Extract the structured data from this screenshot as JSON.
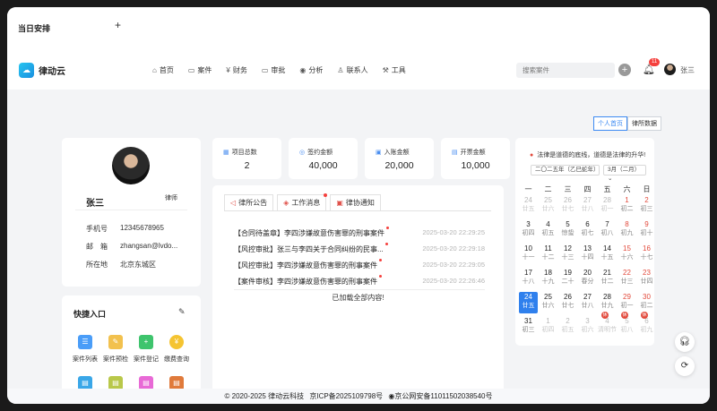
{
  "brand": {
    "name": "律动云",
    "logo_icon": "cloud-icon"
  },
  "nav": [
    {
      "label": "首页",
      "icon": "home-icon"
    },
    {
      "label": "案件",
      "icon": "folder-icon"
    },
    {
      "label": "财务",
      "icon": "money-icon"
    },
    {
      "label": "审批",
      "icon": "folder-icon"
    },
    {
      "label": "分析",
      "icon": "eye-icon"
    },
    {
      "label": "联系人",
      "icon": "people-icon"
    },
    {
      "label": "工具",
      "icon": "tool-icon"
    }
  ],
  "search": {
    "placeholder": "搜索案件"
  },
  "notifications": {
    "count": "11"
  },
  "user": {
    "name": "张三"
  },
  "view_toggle": [
    "个人首页",
    "律所数据"
  ],
  "profile": {
    "name": "张三",
    "role": "律师",
    "rows": [
      {
        "key": "手机号",
        "value": "12345678965"
      },
      {
        "key": "邮　箱",
        "value": "zhangsan@lvdo..."
      },
      {
        "key": "所在地",
        "value": "北京东城区"
      }
    ]
  },
  "shortcuts": {
    "title": "快捷入口",
    "items": [
      {
        "label": "案件列表",
        "color": "#4a9df8"
      },
      {
        "label": "案件预检",
        "color": "#f2c14e"
      },
      {
        "label": "案件登记",
        "color": "#3ec46d"
      },
      {
        "label": "缴费查询",
        "color": "#f5c431"
      },
      {
        "label": "",
        "color": "#3aa7e8"
      },
      {
        "label": "",
        "color": "#b9c84a"
      },
      {
        "label": "",
        "color": "#e86ad6"
      },
      {
        "label": "",
        "color": "#e07a3b"
      }
    ]
  },
  "stats": [
    {
      "label": "项目总数",
      "value": "2"
    },
    {
      "label": "签约金额",
      "value": "40,000"
    },
    {
      "label": "入账金额",
      "value": "20,000"
    },
    {
      "label": "开票金额",
      "value": "10,000"
    }
  ],
  "messages": {
    "tabs": [
      "律所公告",
      "工作消息",
      "律协通知"
    ],
    "rows": [
      {
        "title": "【合同待盖章】李四涉嫌故意伤害罪的刑事案件",
        "date": "2025-03-20 22:29:25"
      },
      {
        "title": "【风控审批】张三与李四关于合同纠纷的民事...",
        "date": "2025-03-20 22:29:18"
      },
      {
        "title": "【风控审批】李四涉嫌故意伤害罪的刑事案件",
        "date": "2025-03-20 22:29:05"
      },
      {
        "title": "【案件审核】李四涉嫌故意伤害罪的刑事案件",
        "date": "2025-03-20 22:26:46"
      }
    ],
    "end_text": "已加载全部内容!"
  },
  "calendar": {
    "slogan": "法律是道德的底线，道德是法律的升华!",
    "year_select": "二〇二五年（乙巳蛇年）",
    "month_select": "3月（二月）",
    "weekdays": [
      "一",
      "二",
      "三",
      "四",
      "五",
      "六",
      "日"
    ],
    "weeks": [
      [
        {
          "n": "24",
          "l": "廿五",
          "o": true
        },
        {
          "n": "25",
          "l": "廿六",
          "o": true
        },
        {
          "n": "26",
          "l": "廿七",
          "o": true
        },
        {
          "n": "27",
          "l": "廿八",
          "o": true
        },
        {
          "n": "28",
          "l": "初一",
          "o": true
        },
        {
          "n": "1",
          "l": "初二"
        },
        {
          "n": "2",
          "l": "初三"
        }
      ],
      [
        {
          "n": "3",
          "l": "初四"
        },
        {
          "n": "4",
          "l": "初五"
        },
        {
          "n": "5",
          "l": "惊蛰"
        },
        {
          "n": "6",
          "l": "初七"
        },
        {
          "n": "7",
          "l": "初八"
        },
        {
          "n": "8",
          "l": "初九"
        },
        {
          "n": "9",
          "l": "初十"
        }
      ],
      [
        {
          "n": "10",
          "l": "十一"
        },
        {
          "n": "11",
          "l": "十二"
        },
        {
          "n": "12",
          "l": "十三"
        },
        {
          "n": "13",
          "l": "十四"
        },
        {
          "n": "14",
          "l": "十五"
        },
        {
          "n": "15",
          "l": "十六"
        },
        {
          "n": "16",
          "l": "十七"
        }
      ],
      [
        {
          "n": "17",
          "l": "十八"
        },
        {
          "n": "18",
          "l": "十九"
        },
        {
          "n": "19",
          "l": "二十"
        },
        {
          "n": "20",
          "l": "春分"
        },
        {
          "n": "21",
          "l": "廿二"
        },
        {
          "n": "22",
          "l": "廿三"
        },
        {
          "n": "23",
          "l": "廿四"
        }
      ],
      [
        {
          "n": "24",
          "l": "廿五",
          "t": true
        },
        {
          "n": "25",
          "l": "廿六"
        },
        {
          "n": "26",
          "l": "廿七"
        },
        {
          "n": "27",
          "l": "廿八"
        },
        {
          "n": "28",
          "l": "廿九"
        },
        {
          "n": "29",
          "l": "初一"
        },
        {
          "n": "30",
          "l": "初二"
        }
      ],
      [
        {
          "n": "31",
          "l": "初三"
        },
        {
          "n": "1",
          "l": "初四",
          "o": true
        },
        {
          "n": "2",
          "l": "初五",
          "o": true
        },
        {
          "n": "3",
          "l": "初六",
          "o": true
        },
        {
          "n": "4",
          "l": "清明节",
          "o": true
        },
        {
          "n": "5",
          "l": "初八",
          "o": true,
          "b": "休"
        },
        {
          "n": "6",
          "l": "初九",
          "o": true,
          "b": "休"
        }
      ]
    ],
    "holiday_badges": [
      "休",
      "休",
      "休"
    ]
  },
  "schedule": {
    "title": "当日安排"
  },
  "footer": {
    "copyright": "© 2020-2025 律动云科技",
    "icp": "京ICP备2025109798号",
    "police": "京公网安备11011502038540号"
  }
}
